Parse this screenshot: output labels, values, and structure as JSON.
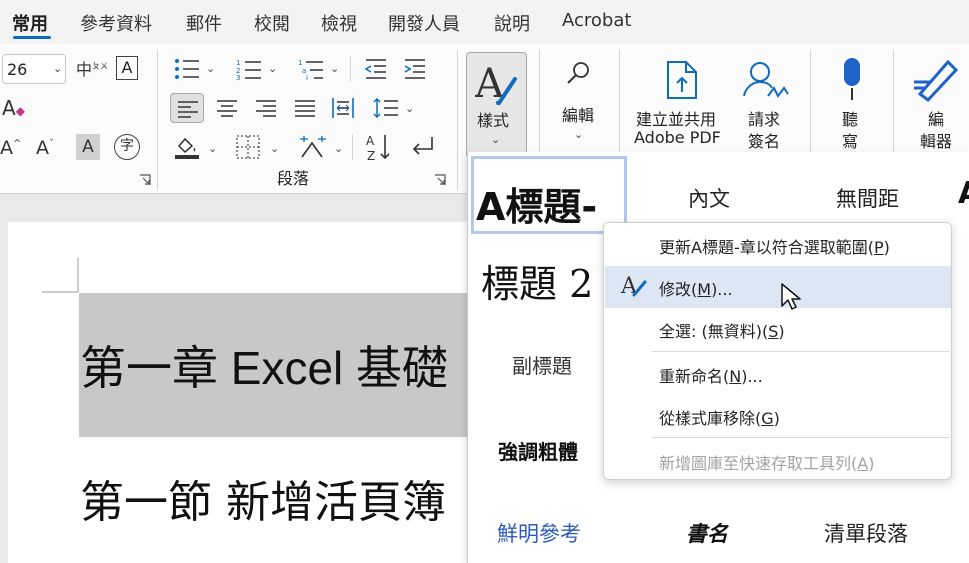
{
  "tabs": [
    "常用",
    "參考資料",
    "郵件",
    "校閱",
    "檢視",
    "開發人員",
    "說明",
    "Acrobat"
  ],
  "font": {
    "size_value": "26",
    "zhuyin_icon": "中",
    "zhuyin_small": "ㄆㄨ",
    "border_letter": "A",
    "clear_letter": "A",
    "grow_letter": "A",
    "shrink_letter": "A",
    "shade_letter": "A",
    "enclose_char": "字"
  },
  "paragraph": {
    "group_label": "段落"
  },
  "styles_btn": {
    "label": "樣式"
  },
  "editing": {
    "label": "編\n輯"
  },
  "adobe": {
    "create_label_1": "建立並共用",
    "create_label_2": "Adobe PDF",
    "sign_label_1": "請求",
    "sign_label_2": "簽名"
  },
  "dictate": {
    "label_1": "聽",
    "label_2": "寫"
  },
  "editor": {
    "label_1": "編",
    "label_2": "輯器"
  },
  "document": {
    "heading1": "第一章 Excel 基礎",
    "heading2": "第一節 新增活頁簿"
  },
  "gallery": {
    "row1": [
      "A標題-",
      "內文",
      "無間距",
      "A"
    ],
    "heading2": "標題 2",
    "subtitle": "副標題",
    "strong": "強調粗體",
    "row_last": [
      "鮮明參考",
      "書名",
      "清單段落"
    ]
  },
  "context_menu": {
    "items": [
      {
        "label": "更新A標題-章以符合選取範圍(",
        "key": "P",
        "tail": ")",
        "disabled": false
      },
      {
        "label": "修改(",
        "key": "M",
        "tail": ")...",
        "disabled": false
      },
      {
        "label": "全選: (無資料)(",
        "key": "S",
        "tail": ")",
        "disabled": false
      },
      {
        "label": "重新命名(",
        "key": "N",
        "tail": ")...",
        "disabled": false
      },
      {
        "label": "從樣式庫移除(",
        "key": "G",
        "tail": ")",
        "disabled": false
      },
      {
        "label": "新增圖庫至快速存取工具列(",
        "key": "A",
        "tail": ")",
        "disabled": true
      }
    ]
  },
  "colors": {
    "accent": "#0f6cbd",
    "menu_highlight": "#dde6f3",
    "heading_band": "#c8c8c8",
    "intense_ref": "#2f5cb8"
  }
}
